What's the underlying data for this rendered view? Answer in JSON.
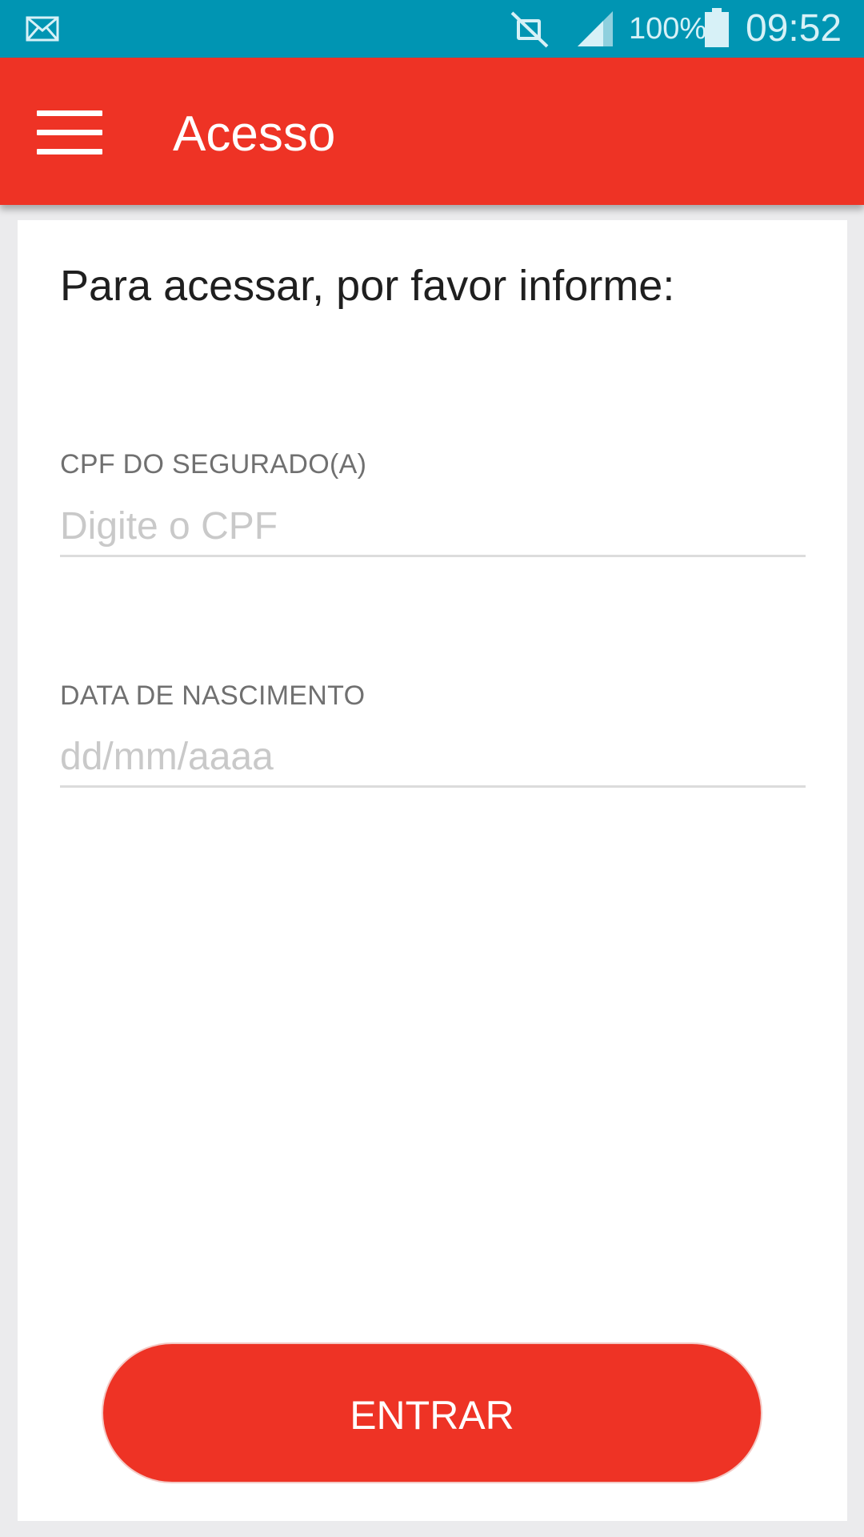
{
  "status_bar": {
    "battery_percent": "100%",
    "time": "09:52",
    "icons": [
      "mail-icon",
      "mute-icon",
      "signal-icon",
      "battery-icon"
    ]
  },
  "app_bar": {
    "title": "Acesso",
    "color": "#ee3325"
  },
  "form": {
    "intro": "Para acessar, por favor informe:",
    "cpf": {
      "label": "CPF DO SEGURADO(A)",
      "placeholder": "Digite o CPF",
      "value": ""
    },
    "birth_date": {
      "label": "DATA DE NASCIMENTO",
      "placeholder": "dd/mm/aaaa",
      "value": ""
    },
    "submit_label": "ENTRAR"
  }
}
